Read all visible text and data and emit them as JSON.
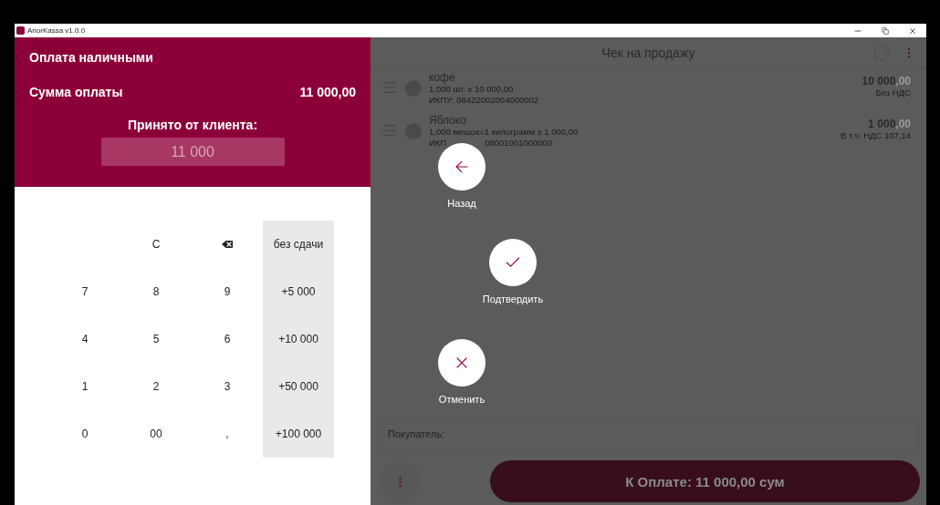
{
  "window": {
    "title": "AnorKassa v1.0.0"
  },
  "payment_panel": {
    "title": "Оплата наличными",
    "amount_label": "Сумма оплаты",
    "amount": "11 000,00",
    "received_label": "Принято от клиента:",
    "received_value": "11 000"
  },
  "keypad": {
    "rows": [
      [
        {
          "kind": "empty"
        },
        {
          "kind": "key",
          "label": "C"
        },
        {
          "kind": "backspace"
        },
        {
          "kind": "quick",
          "label": "без сдачи"
        }
      ],
      [
        {
          "kind": "key",
          "label": "7"
        },
        {
          "kind": "key",
          "label": "8"
        },
        {
          "kind": "key",
          "label": "9"
        },
        {
          "kind": "quick",
          "label": "+5 000"
        }
      ],
      [
        {
          "kind": "key",
          "label": "4"
        },
        {
          "kind": "key",
          "label": "5"
        },
        {
          "kind": "key",
          "label": "6"
        },
        {
          "kind": "quick",
          "label": "+10 000"
        }
      ],
      [
        {
          "kind": "key",
          "label": "1"
        },
        {
          "kind": "key",
          "label": "2"
        },
        {
          "kind": "key",
          "label": "3"
        },
        {
          "kind": "quick",
          "label": "+50 000"
        }
      ],
      [
        {
          "kind": "key",
          "label": "0"
        },
        {
          "kind": "key",
          "label": "00"
        },
        {
          "kind": "key",
          "label": ","
        },
        {
          "kind": "quick",
          "label": "+100 000"
        }
      ]
    ]
  },
  "receipt": {
    "title": "Чек на продажу",
    "items": [
      {
        "name": "кофе",
        "quantity": "1,000 шт. x 10 000,00",
        "code_parts": [
          "ИКПУ: 08422002004000002"
        ],
        "price": "10 000",
        "price_decimals": ",00",
        "tax": "Без НДС"
      },
      {
        "name": "Яблоко",
        "quantity": "1,000 мешок=1 килограмм x 1 000,00",
        "code_parts": [
          "ИКП",
          "08001001000000"
        ],
        "price": "1 000",
        "price_decimals": ",00",
        "tax": "В т.ч. НДС 107,14"
      }
    ],
    "buyer_label": "Покупатель:",
    "pay_button": "К Оплате: 11 000,00 сум"
  },
  "actions": [
    {
      "kind": "back",
      "label": "Назад"
    },
    {
      "kind": "confirm",
      "label": "Подтвердить"
    },
    {
      "kind": "cancel",
      "label": "Отменить"
    }
  ]
}
